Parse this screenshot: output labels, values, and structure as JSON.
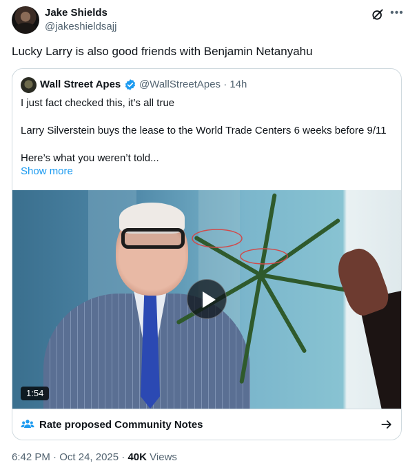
{
  "tweet": {
    "author_name": "Jake Shields",
    "author_handle": "@jakeshieldsajj",
    "text": "Lucky Larry is also good friends with Benjamin Netanyahu",
    "time": "6:42 PM",
    "sep1": "·",
    "date": "Oct 24, 2025",
    "sep2": "·",
    "views_count": "40K",
    "views_label": "Views"
  },
  "quote": {
    "author_name": "Wall Street Apes",
    "author_handle": "@WallStreetApes · 14h",
    "line1": "I just fact checked this, it’s all true",
    "line2": "Larry Silverstein buys the lease to the World Trade Centers 6 weeks before 9/11",
    "line3": "Here’s what you weren’t told...",
    "show_more": "Show more",
    "video_duration": "1:54",
    "community_notes_label": "Rate proposed Community Notes"
  },
  "icons": {
    "grok": "grok-icon",
    "more": "more-icon",
    "verified": "verified-badge-icon",
    "play": "play-icon",
    "people": "people-icon",
    "arrow": "arrow-right-icon"
  },
  "colors": {
    "link": "#1d9bf0",
    "secondary_text": "#536471",
    "border": "#cfd9de"
  }
}
